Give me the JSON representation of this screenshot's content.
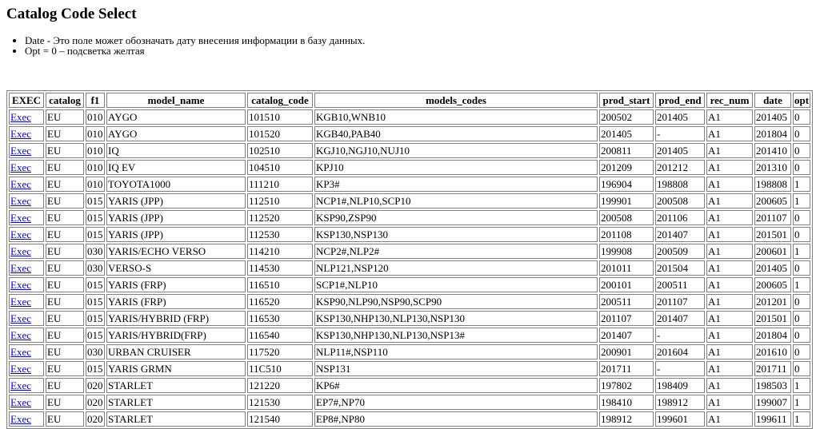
{
  "page": {
    "title": "Catalog Code Select",
    "notes": [
      "Date - Это поле может обозначать дату внесения информации в базу данных.",
      "Opt = 0 – подсветка желтая"
    ]
  },
  "table": {
    "columns": [
      "EXEC",
      "catalog",
      "f1",
      "model_name",
      "catalog_code",
      "models_codes",
      "prod_start",
      "prod_end",
      "rec_num",
      "date",
      "opt"
    ],
    "rows": [
      [
        "Exec",
        "EU",
        "010",
        "AYGO",
        "101510",
        "KGB10,WNB10",
        "200502",
        "201405",
        "A1",
        "201405",
        "0"
      ],
      [
        "Exec",
        "EU",
        "010",
        "AYGO",
        "101520",
        "KGB40,PAB40",
        "201405",
        "-",
        "A1",
        "201804",
        "0"
      ],
      [
        "Exec",
        "EU",
        "010",
        "IQ",
        "102510",
        "KGJ10,NGJ10,NUJ10",
        "200811",
        "201405",
        "A1",
        "201410",
        "0"
      ],
      [
        "Exec",
        "EU",
        "010",
        "IQ EV",
        "104510",
        "KPJ10",
        "201209",
        "201212",
        "A1",
        "201310",
        "0"
      ],
      [
        "Exec",
        "EU",
        "010",
        "TOYOTA1000",
        "111210",
        "KP3#",
        "196904",
        "198808",
        "A1",
        "198808",
        "1"
      ],
      [
        "Exec",
        "EU",
        "015",
        "YARIS (JPP)",
        "112510",
        "NCP1#,NLP10,SCP10",
        "199901",
        "200508",
        "A1",
        "200605",
        "1"
      ],
      [
        "Exec",
        "EU",
        "015",
        "YARIS (JPP)",
        "112520",
        "KSP90,ZSP90",
        "200508",
        "201106",
        "A1",
        "201107",
        "0"
      ],
      [
        "Exec",
        "EU",
        "015",
        "YARIS (JPP)",
        "112530",
        "KSP130,NSP130",
        "201108",
        "201407",
        "A1",
        "201501",
        "0"
      ],
      [
        "Exec",
        "EU",
        "030",
        "YARIS/ECHO VERSO",
        "114210",
        "NCP2#,NLP2#",
        "199908",
        "200509",
        "A1",
        "200601",
        "1"
      ],
      [
        "Exec",
        "EU",
        "030",
        "VERSO-S",
        "114530",
        "NLP121,NSP120",
        "201011",
        "201504",
        "A1",
        "201405",
        "0"
      ],
      [
        "Exec",
        "EU",
        "015",
        "YARIS (FRP)",
        "116510",
        "SCP1#,NLP10",
        "200101",
        "200511",
        "A1",
        "200605",
        "1"
      ],
      [
        "Exec",
        "EU",
        "015",
        "YARIS (FRP)",
        "116520",
        "KSP90,NLP90,NSP90,SCP90",
        "200511",
        "201107",
        "A1",
        "201201",
        "0"
      ],
      [
        "Exec",
        "EU",
        "015",
        "YARIS/HYBRID (FRP)",
        "116530",
        "KSP130,NHP130,NLP130,NSP130",
        "201107",
        "201407",
        "A1",
        "201501",
        "0"
      ],
      [
        "Exec",
        "EU",
        "015",
        "YARIS/HYBRID(FRP)",
        "116540",
        "KSP130,NHP130,NLP130,NSP13#",
        "201407",
        "-",
        "A1",
        "201804",
        "0"
      ],
      [
        "Exec",
        "EU",
        "030",
        "URBAN CRUISER",
        "117520",
        "NLP11#,NSP110",
        "200901",
        "201604",
        "A1",
        "201610",
        "0"
      ],
      [
        "Exec",
        "EU",
        "015",
        "YARIS GRMN",
        "11C510",
        "NSP131",
        "201711",
        "-",
        "A1",
        "201711",
        "0"
      ],
      [
        "Exec",
        "EU",
        "020",
        "STARLET",
        "121220",
        "KP6#",
        "197802",
        "198409",
        "A1",
        "198503",
        "1"
      ],
      [
        "Exec",
        "EU",
        "020",
        "STARLET",
        "121530",
        "EP7#,NP70",
        "198410",
        "198912",
        "A1",
        "199007",
        "1"
      ],
      [
        "Exec",
        "EU",
        "020",
        "STARLET",
        "121540",
        "EP8#,NP80",
        "198912",
        "199601",
        "A1",
        "199611",
        "1"
      ]
    ]
  }
}
